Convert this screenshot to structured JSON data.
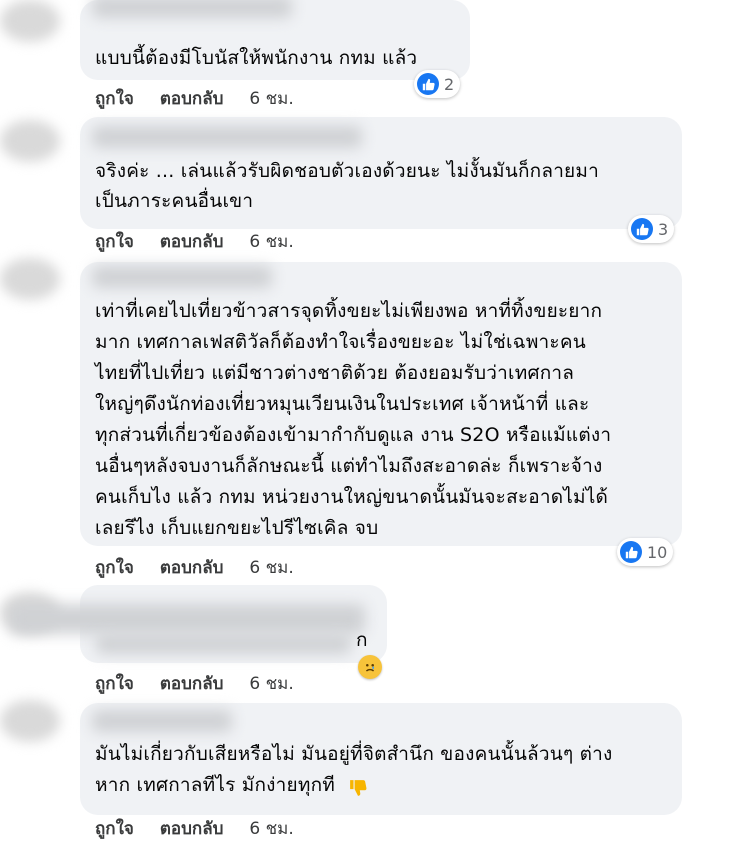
{
  "comments": [
    {
      "lines": [
        "แบบนี้ต้องมีโบนัสให้พนักงาน กทม แล้ว"
      ],
      "reactions": "2",
      "actions": {
        "like": "ถูกใจ",
        "reply": "ตอบกลับ",
        "time": "6 ชม."
      }
    },
    {
      "lines": [
        "จริงค่ะ ... เล่นแล้วรับผิดชอบตัวเองด้วยนะ ไม่งั้นมันก็กลายมา",
        "เป็นภาระคนอื่นเขา"
      ],
      "reactions": "3",
      "actions": {
        "like": "ถูกใจ",
        "reply": "ตอบกลับ",
        "time": "6 ชม."
      }
    },
    {
      "lines": [
        "เท่าที่เคยไปเที่ยวข้าวสารจุดทิ้งขยะไม่เพียงพอ หาที่ทิ้งขยะยาก",
        "มาก เทศกาลเฟสติวัลก็ต้องทำใจเรื่องขยะอะ ไม่ใช่เฉพาะคน",
        "ไทยที่ไปเที่ยว แต่มีชาวต่างชาติด้วย ต้องยอมรับว่าเทศกาล",
        "ใหญ่ๆดึงนักท่องเที่ยวหมุนเวียนเงินในประเทศ เจ้าหน้าที่ และ",
        "ทุกส่วนที่เกี่ยวข้องต้องเข้ามากำกับดูแล งาน S2O หรือแม้แต่งา",
        "นอื่นๆหลังจบงานก็ลักษณะนี้ แต่ทำไมถึงสะอาดล่ะ ก็เพราะจ้าง",
        "คนเก็บไง แล้ว กทม หน่วยงานใหญ่ขนาดนั้นมันจะสะอาดไม่ได้",
        "เลยรึไง เก็บแยกขยะไปรีไซเคิล จบ"
      ],
      "reactions": "10",
      "actions": {
        "like": "ถูกใจ",
        "reply": "ตอบกลับ",
        "time": "6 ชม."
      }
    },
    {
      "lines": [
        "ก"
      ],
      "actions": {
        "like": "ถูกใจ",
        "reply": "ตอบกลับ",
        "time": "6 ชม."
      }
    },
    {
      "lines": [
        "มันไม่เกี่ยวกับเสียหรือไม่ มันอยู่ที่จิตสำนึก ของคนนั้นล้วนๆ ต่าง",
        "หาก เทศกาลทีไร มักง่ายทุกที"
      ],
      "actions": {
        "like": "ถูกใจ",
        "reply": "ตอบกลับ",
        "time": "6 ชม."
      }
    }
  ]
}
